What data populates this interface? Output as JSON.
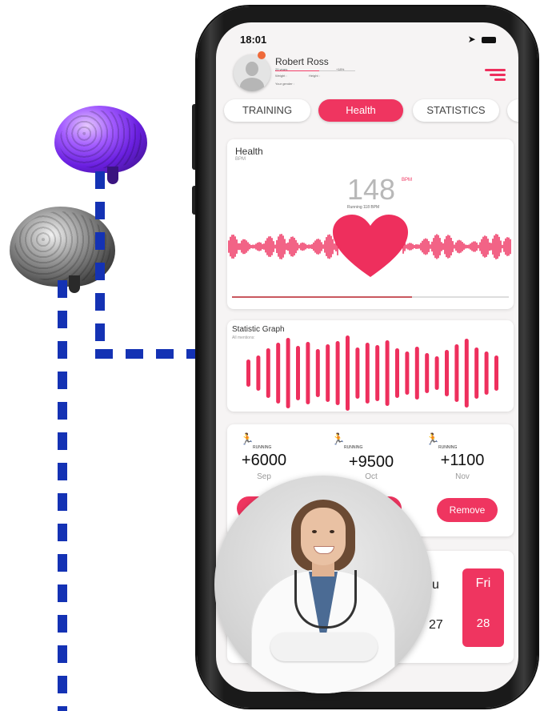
{
  "status_bar": {
    "time": "18:01",
    "icons": "➤"
  },
  "profile": {
    "name": "Robert Ross",
    "age": "29 years",
    "percent": "+18%",
    "weight_label": "Weight :",
    "height_label": "Height :",
    "gender_label": "Your gender :",
    "progress": 0.55
  },
  "tabs": [
    {
      "label": "TRAINING",
      "active": false
    },
    {
      "label": "Health",
      "active": true
    },
    {
      "label": "STATISTICS",
      "active": false
    }
  ],
  "health_card": {
    "title": "Health",
    "subtitle": "BPM",
    "bpm_value": "148",
    "bpm_unit": "BPM",
    "running_text": "Running 118 BPM",
    "progress": 0.65
  },
  "statistic_card": {
    "title": "Statistic Graph",
    "subtitle": "All mentions:"
  },
  "running_stats": [
    {
      "label": "RUNNING",
      "value": "+6000",
      "month": "Sep"
    },
    {
      "label": "RUNNING",
      "value": "+9500",
      "month": "Oct"
    },
    {
      "label": "RUNNING",
      "value": "+1100",
      "month": "Nov"
    }
  ],
  "remove_button": "Remove",
  "days": {
    "partial_day": "u",
    "partial_date": "27",
    "selected_day": "Fri",
    "selected_date": "28"
  },
  "colors": {
    "accent": "#ef3560",
    "connector": "#1432b4",
    "background": "#f6f4f4"
  }
}
